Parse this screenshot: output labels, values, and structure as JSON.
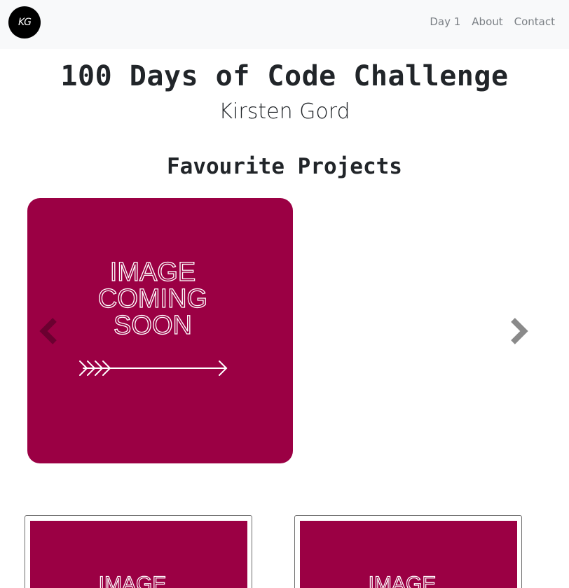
{
  "navbar": {
    "logo_text": "KG",
    "links": [
      "Day 1",
      "About",
      "Contact"
    ]
  },
  "header": {
    "title": "100 Days of Code Challenge",
    "subtitle": "Kirsten Gord"
  },
  "projects": {
    "section_title": "Favourite Projects",
    "placeholder_lines": [
      "IMAGE",
      "COMING",
      "SOON"
    ],
    "card_placeholder_text": "IMAGE"
  },
  "colors": {
    "placeholder_bg": "#9b0044",
    "navbar_bg": "#f8f9fa",
    "nav_link": "#7a7f84"
  },
  "icons": {
    "prev": "chevron-left-icon",
    "next": "chevron-right-icon",
    "arrow": "arrow-right-icon"
  }
}
